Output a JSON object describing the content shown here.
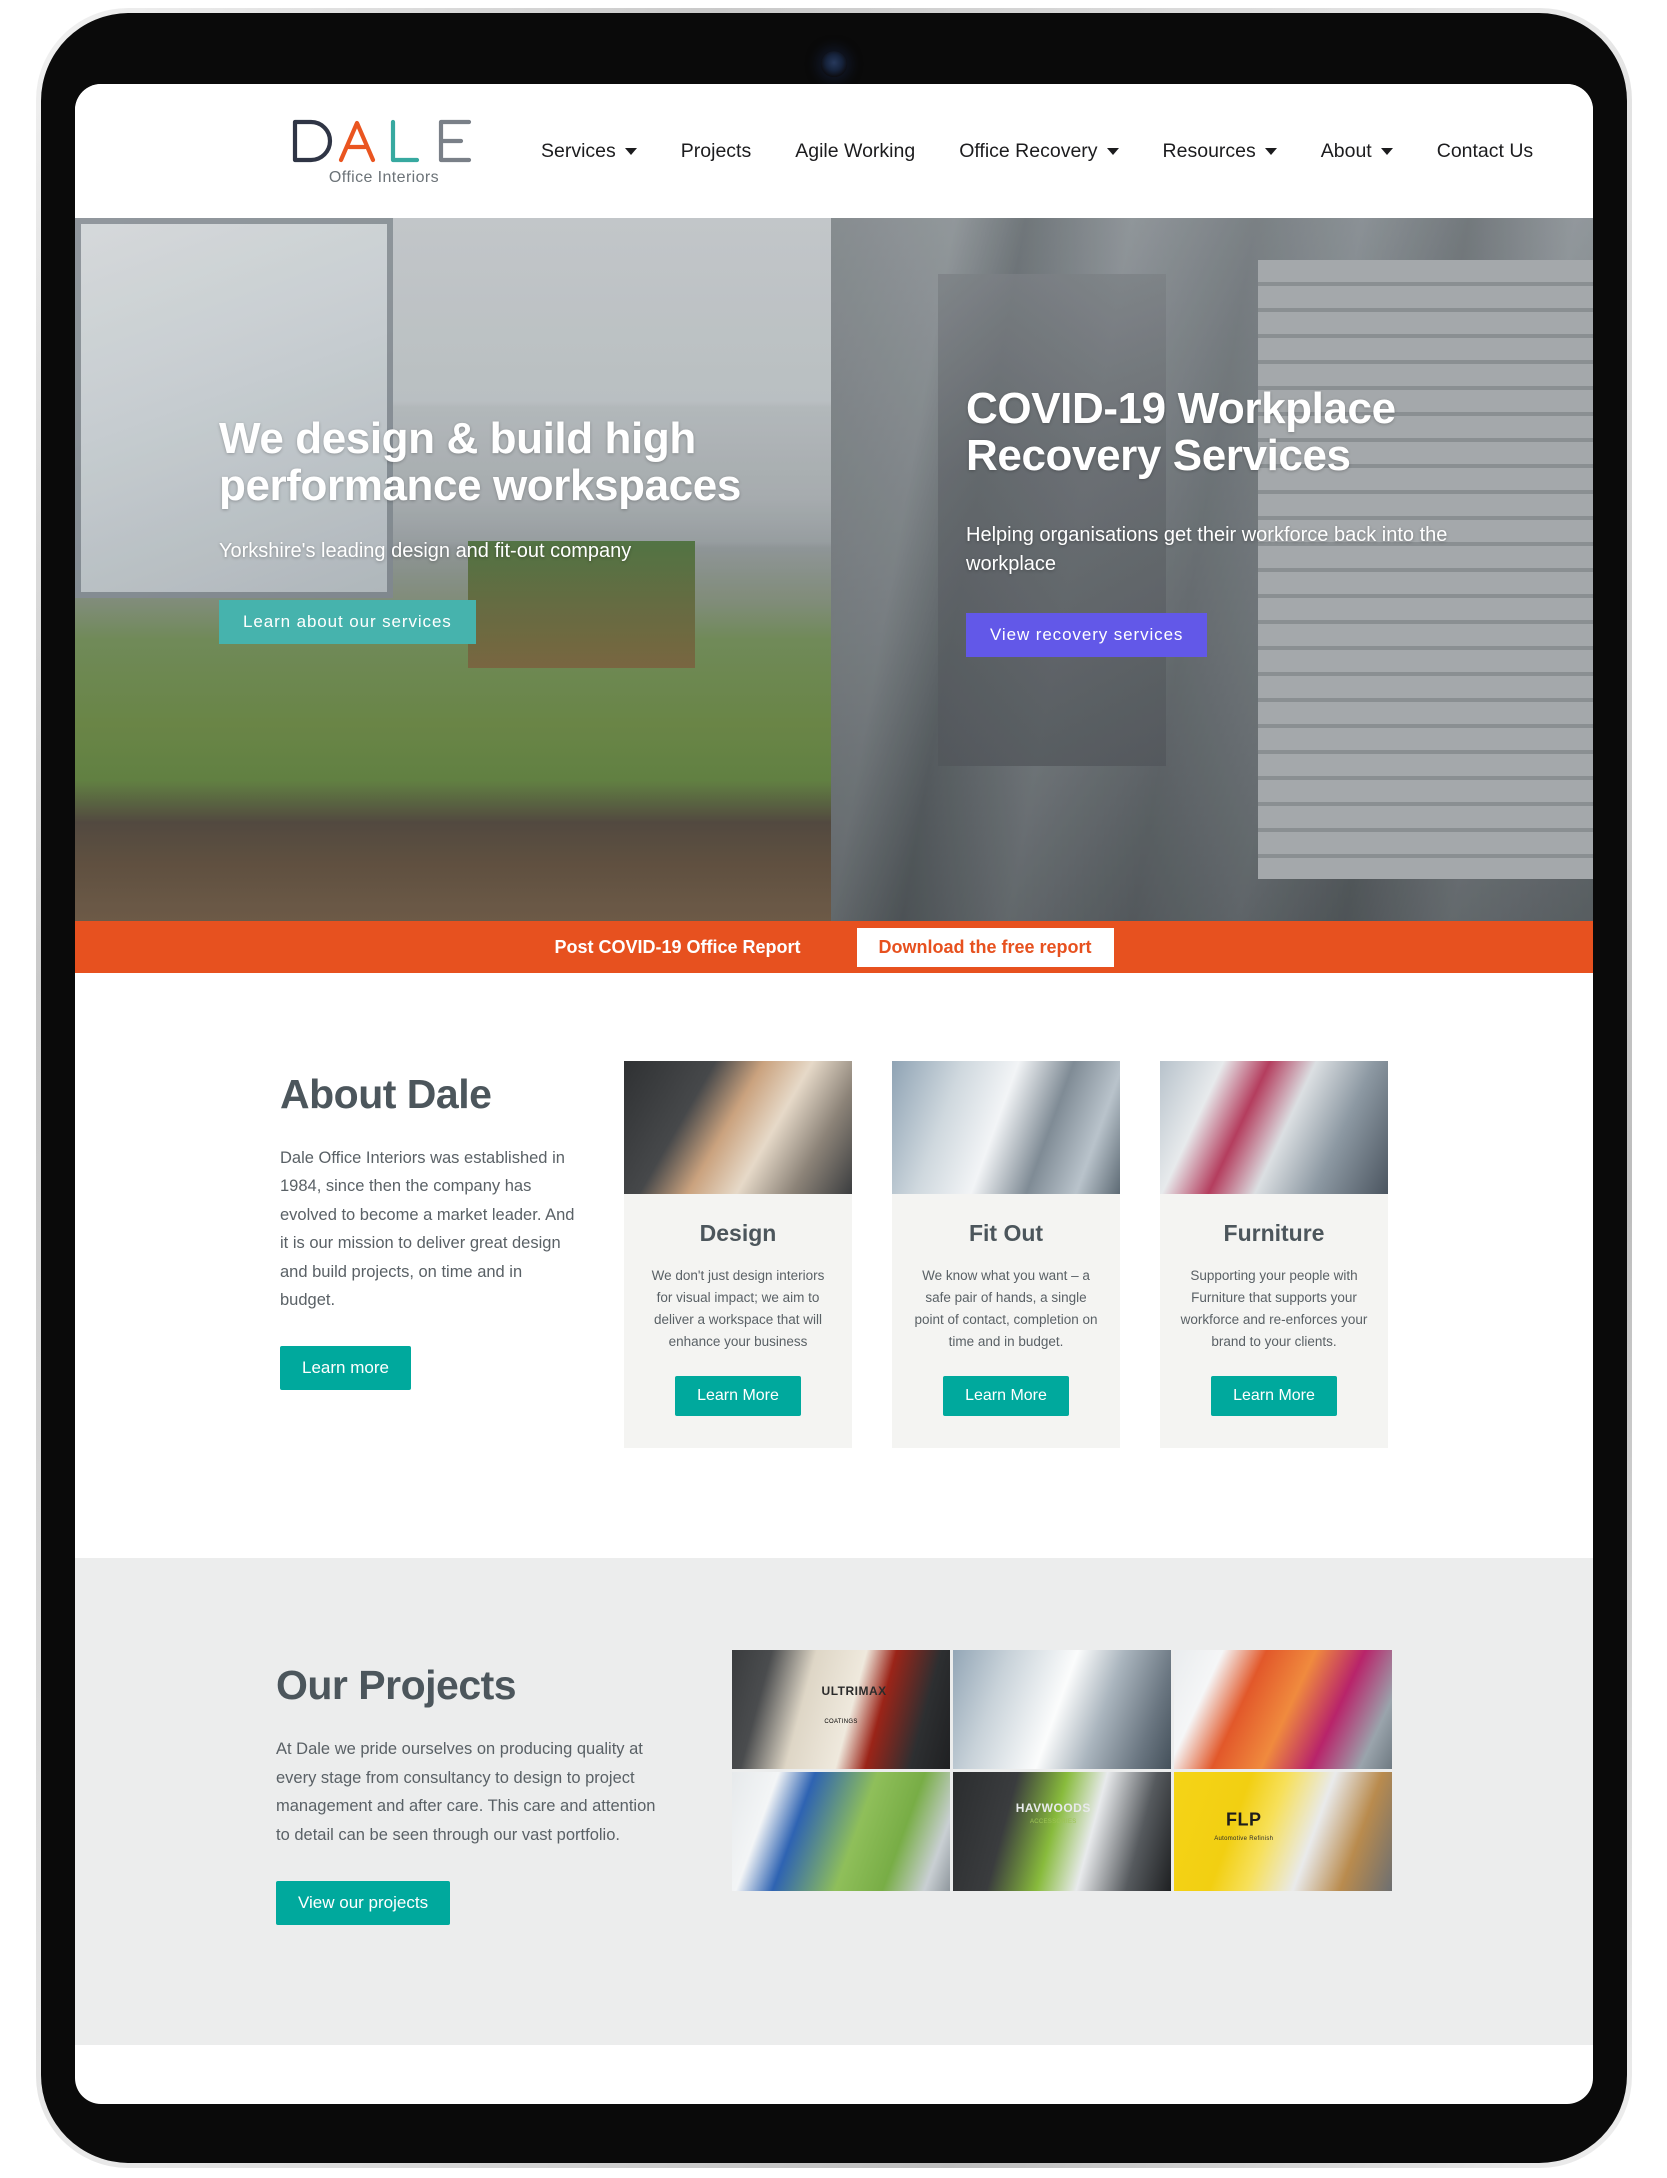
{
  "brand": {
    "logo_letters": [
      "D",
      "A",
      "L",
      "E"
    ],
    "logo_tagline": "Office Interiors",
    "colors": {
      "logo_d": "#2f3545",
      "logo_a": "#ea5520",
      "logo_l": "#37a9a0",
      "logo_e": "#7a8088",
      "teal": "#00a99d",
      "hero_teal": "#46b3ad",
      "indigo": "#6258e8",
      "orange": "#e7511f",
      "heading_grey": "#4c565c"
    }
  },
  "nav": {
    "items": [
      {
        "label": "Services",
        "has_dropdown": true
      },
      {
        "label": "Projects",
        "has_dropdown": false
      },
      {
        "label": "Agile Working",
        "has_dropdown": false
      },
      {
        "label": "Office Recovery",
        "has_dropdown": true
      },
      {
        "label": "Resources",
        "has_dropdown": true
      },
      {
        "label": "About",
        "has_dropdown": true
      },
      {
        "label": "Contact Us",
        "has_dropdown": false
      }
    ]
  },
  "hero": {
    "left": {
      "title": "We design & build high performance workspaces",
      "subtitle": "Yorkshire's leading design and  fit-out company",
      "button": "Learn about our services"
    },
    "right": {
      "title": "COVID-19 Workplace Recovery Services",
      "subtitle": "Helping organisations get their workforce back into the workplace",
      "button": "View recovery services"
    }
  },
  "report_bar": {
    "text": "Post COVID-19 Office Report",
    "button": "Download the free report"
  },
  "about": {
    "title": "About Dale",
    "body": "Dale Office Interiors was established in 1984, since then the company has evolved to become a market leader. And it is our mission to deliver great design and build projects, on time and in budget.",
    "button": "Learn more",
    "cards": [
      {
        "title": "Design",
        "text": "We don't just design interiors for visual impact; we aim to deliver a workspace that will enhance your business",
        "button": "Learn More"
      },
      {
        "title": "Fit Out",
        "text": "We know what you want – a safe pair of hands, a single point of contact, completion on time and in budget.",
        "button": "Learn More"
      },
      {
        "title": "Furniture",
        "text": "Supporting your people with Furniture that supports your workforce and re-enforces your brand to your clients.",
        "button": "Learn More"
      }
    ]
  },
  "projects": {
    "title": "Our Projects",
    "body": "At Dale we pride ourselves on producing quality at every stage from consultancy to design to project management and after care. This care and attention to detail can be seen through our vast portfolio.",
    "button": "View our projects",
    "tiles": [
      {
        "label": "ULTRIMAX",
        "sub": "COATINGS"
      },
      {
        "label": "",
        "sub": ""
      },
      {
        "label": "",
        "sub": ""
      },
      {
        "label": "",
        "sub": ""
      },
      {
        "label": "HAVWOODS",
        "sub": "ACCESSORIES"
      },
      {
        "label": "FLP",
        "sub": "Automotive Refinish"
      }
    ]
  }
}
